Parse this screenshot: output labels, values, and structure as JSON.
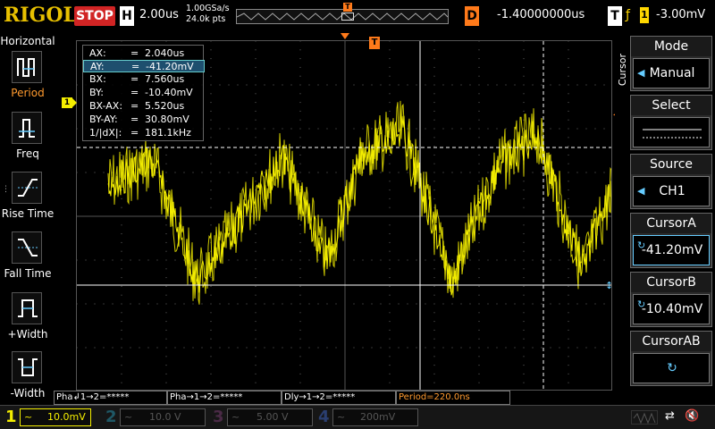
{
  "header": {
    "brand": "RIGOL",
    "run_state": "STOP",
    "h_label": "H",
    "timebase": "2.00us",
    "sample_rate": "1.00GSa/s",
    "mem_depth": "24.0k pts",
    "trig_marker": "T",
    "d_label": "D",
    "delay": "-1.40000000us",
    "t_label": "T",
    "trig_edge": "ƒ",
    "trig_source": "1",
    "trig_level": "-3.00mV"
  },
  "left_menu": {
    "title": "Horizontal",
    "items": [
      {
        "label": "Period",
        "icon": "period-icon"
      },
      {
        "label": "Freq",
        "icon": "freq-icon"
      },
      {
        "label": "Rise Time",
        "icon": "rise-time-icon"
      },
      {
        "label": "Fall Time",
        "icon": "fall-time-icon"
      },
      {
        "label": "+Width",
        "icon": "plus-width-icon"
      },
      {
        "label": "-Width",
        "icon": "minus-width-icon"
      }
    ]
  },
  "cursor_readout": {
    "rows": [
      {
        "label": "AX:",
        "eq": "=",
        "value": "2.040us"
      },
      {
        "label": "AY:",
        "eq": "=",
        "value": "-41.20mV"
      },
      {
        "label": "BX:",
        "eq": "=",
        "value": "7.560us"
      },
      {
        "label": "BY:",
        "eq": "=",
        "value": "-10.40mV"
      },
      {
        "label": "BX-AX:",
        "eq": "=",
        "value": "5.520us"
      },
      {
        "label": "BY-AY:",
        "eq": "=",
        "value": "30.80mV"
      },
      {
        "label": "1/|dX|:",
        "eq": "=",
        "value": "181.1kHz"
      }
    ]
  },
  "screen_markers": {
    "ch1": "1",
    "trigger": "T"
  },
  "right_menu": {
    "vertical_title": "Cursor",
    "items": [
      {
        "head": "Mode",
        "value": "Manual"
      },
      {
        "head": "Select",
        "value": ""
      },
      {
        "head": "Source",
        "value": "CH1"
      },
      {
        "head": "CursorA",
        "value": "-41.20mV"
      },
      {
        "head": "CursorB",
        "value": "-10.40mV"
      },
      {
        "head": "CursorAB",
        "value": ""
      }
    ]
  },
  "status_row": {
    "cells": [
      "Pha↲1→2=*****",
      "Pha→1→2=*****",
      "Dly→1→2=*****",
      "Period=220.0ns"
    ]
  },
  "channels": [
    {
      "num": "1",
      "coupling": "~",
      "scale": "10.0mV",
      "color": "#f5ef00",
      "active": true
    },
    {
      "num": "2",
      "coupling": "~",
      "scale": "10.0 V",
      "color": "#1fa3b8",
      "active": false
    },
    {
      "num": "3",
      "coupling": "~",
      "scale": "5.00 V",
      "color": "#b04aa0",
      "active": false
    },
    {
      "num": "4",
      "coupling": "~",
      "scale": "200mV",
      "color": "#3a6fd8",
      "active": false
    }
  ],
  "colors": {
    "trace": "#f5ef00",
    "trigger": "#ff7a1a",
    "accent": "#6cf"
  }
}
